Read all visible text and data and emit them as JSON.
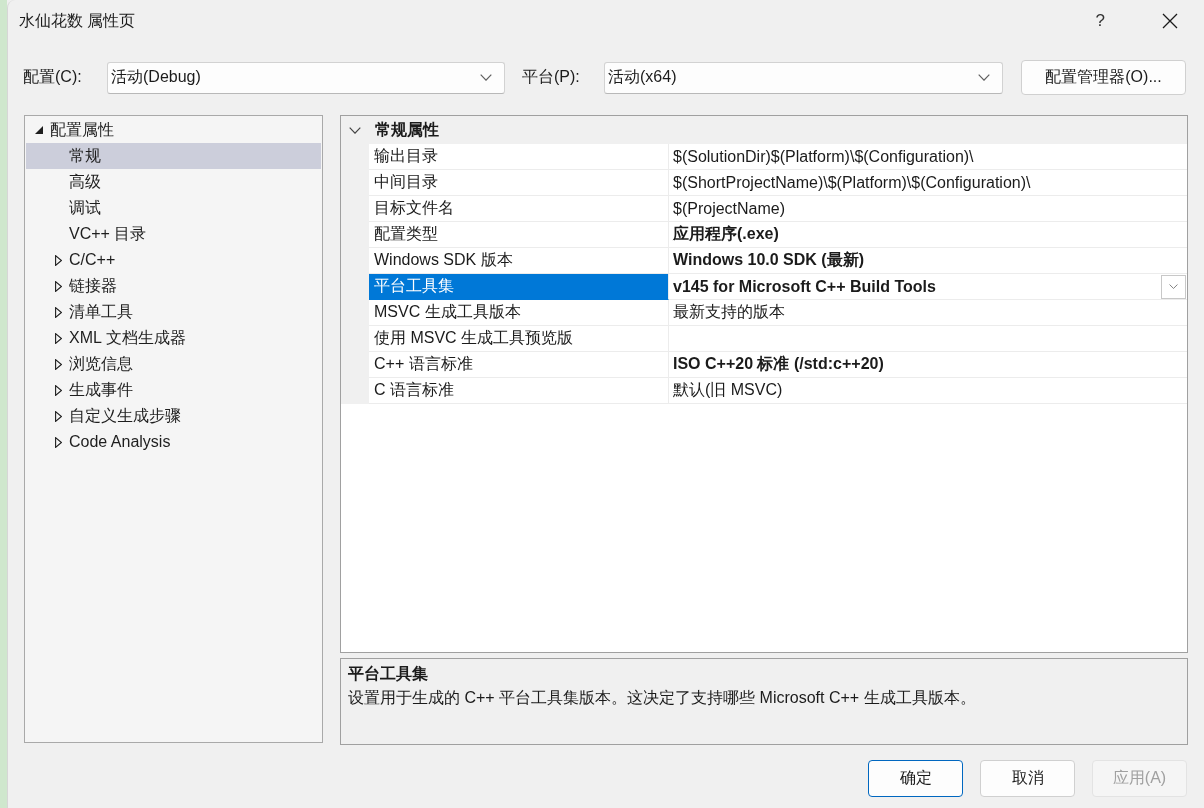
{
  "window": {
    "title": "水仙花数 属性页",
    "help": "?"
  },
  "config_bar": {
    "configuration": {
      "label": "配置(C):",
      "value": "活动(Debug)"
    },
    "platform": {
      "label": "平台(P):",
      "value": "活动(x64)"
    },
    "manager_button": "配置管理器(O)..."
  },
  "tree": {
    "items": [
      {
        "label": "配置属性",
        "kind": "group",
        "expanded": true,
        "selected": false,
        "children": [
          {
            "label": "常规",
            "kind": "leaf",
            "selected": true
          },
          {
            "label": "高级",
            "kind": "leaf",
            "selected": false
          },
          {
            "label": "调试",
            "kind": "leaf",
            "selected": false
          },
          {
            "label": "VC++ 目录",
            "kind": "leaf",
            "selected": false
          },
          {
            "label": "C/C++",
            "kind": "group",
            "expanded": false,
            "selected": false
          },
          {
            "label": "链接器",
            "kind": "group",
            "expanded": false,
            "selected": false
          },
          {
            "label": "清单工具",
            "kind": "group",
            "expanded": false,
            "selected": false
          },
          {
            "label": "XML 文档生成器",
            "kind": "group",
            "expanded": false,
            "selected": false
          },
          {
            "label": "浏览信息",
            "kind": "group",
            "expanded": false,
            "selected": false
          },
          {
            "label": "生成事件",
            "kind": "group",
            "expanded": false,
            "selected": false
          },
          {
            "label": "自定义生成步骤",
            "kind": "group",
            "expanded": false,
            "selected": false
          },
          {
            "label": "Code Analysis",
            "kind": "group",
            "expanded": false,
            "selected": false
          }
        ]
      }
    ]
  },
  "property_grid": {
    "category": {
      "label": "常规属性",
      "expanded": true
    },
    "rows": [
      {
        "name": "输出目录",
        "value": "$(SolutionDir)$(Platform)\\$(Configuration)\\",
        "modified": false,
        "selected": false
      },
      {
        "name": "中间目录",
        "value": "$(ShortProjectName)\\$(Platform)\\$(Configuration)\\",
        "modified": false,
        "selected": false
      },
      {
        "name": "目标文件名",
        "value": "$(ProjectName)",
        "modified": false,
        "selected": false
      },
      {
        "name": "配置类型",
        "value": "应用程序(.exe)",
        "modified": true,
        "selected": false
      },
      {
        "name": "Windows SDK 版本",
        "value": "Windows 10.0 SDK (最新)",
        "modified": true,
        "selected": false
      },
      {
        "name": "平台工具集",
        "value": "v145 for Microsoft C++ Build Tools",
        "modified": true,
        "selected": true
      },
      {
        "name": "MSVC 生成工具版本",
        "value": "最新支持的版本",
        "modified": false,
        "selected": false
      },
      {
        "name": "使用 MSVC 生成工具预览版",
        "selected": false
      },
      {
        "name": "C++ 语言标准",
        "value": "ISO C++20 标准 (/std:c++20)",
        "modified": true,
        "selected": false
      },
      {
        "name": "C 语言标准",
        "value": "默认(旧 MSVC)",
        "modified": false,
        "selected": false
      }
    ]
  },
  "description": {
    "title": "平台工具集",
    "text": "设置用于生成的 C++ 平台工具集版本。这决定了支持哪些 Microsoft C++ 生成工具版本。"
  },
  "buttons": [
    {
      "label": "确定",
      "default": true,
      "disabled": false
    },
    {
      "label": "取消",
      "default": false,
      "disabled": false
    },
    {
      "label": "应用(A)",
      "default": false,
      "disabled": true
    }
  ]
}
